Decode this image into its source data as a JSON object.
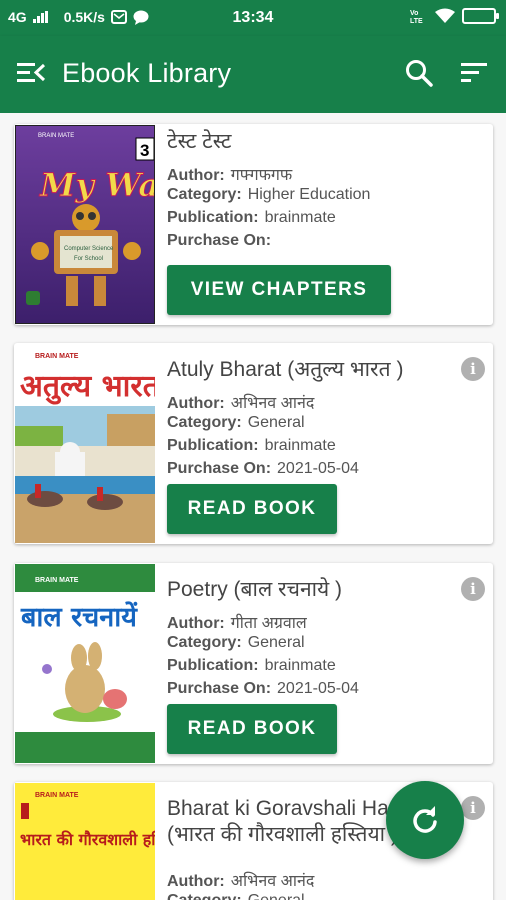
{
  "status_bar": {
    "network": "4G",
    "speed": "0.5K/s",
    "time": "13:34",
    "icons": [
      "signal-icon",
      "message-icon",
      "chat-icon",
      "volte-icon",
      "wifi-icon",
      "battery-icon"
    ]
  },
  "app_bar": {
    "title": "Ebook Library",
    "icons": [
      "menu-open-icon",
      "search-icon",
      "sort-icon"
    ]
  },
  "labels": {
    "author": "Author:",
    "category": "Category:",
    "publication": "Publication:",
    "purchase_on": "Purchase On:"
  },
  "books": [
    {
      "title": "टेस्ट टेस्ट",
      "author": "गफ्गफगफ",
      "category": "Higher Education",
      "publication": "brainmate",
      "purchase_on": "",
      "action": "VIEW CHAPTERS",
      "cover": {
        "title": "My Way",
        "subtitle": "Computer Science For School",
        "badge": "3",
        "brand": "BRAIN MATE"
      }
    },
    {
      "title": "Atuly Bharat (अतुल्य भारत )",
      "author": "अभिनव आनंद",
      "category": "General",
      "publication": "brainmate",
      "purchase_on": "2021-05-04",
      "action": "READ BOOK",
      "cover": {
        "title": "अतुल्य भारत",
        "brand": "BRAIN MATE"
      }
    },
    {
      "title": "Poetry (बाल रचनाये )",
      "author": "गीता अग्रवाल",
      "category": "General",
      "publication": "brainmate",
      "purchase_on": "2021-05-04",
      "action": "READ BOOK",
      "cover": {
        "title": "बाल रचनायें",
        "brand": "BRAIN MATE"
      }
    },
    {
      "title": "Bharat ki Goravshali Hastiyan (भारत की गौरवशाली हस्तिया )",
      "author": "अभिनव आनंद",
      "category": "General",
      "cover": {
        "title": "भारत की गौरवशाली हस्तियाँ",
        "brand": "BRAIN MATE"
      }
    }
  ],
  "fab": {
    "icon": "refresh-icon"
  },
  "colors": {
    "primary": "#17804a",
    "info_icon": "#b0b0b0",
    "title_text": "#444444"
  }
}
